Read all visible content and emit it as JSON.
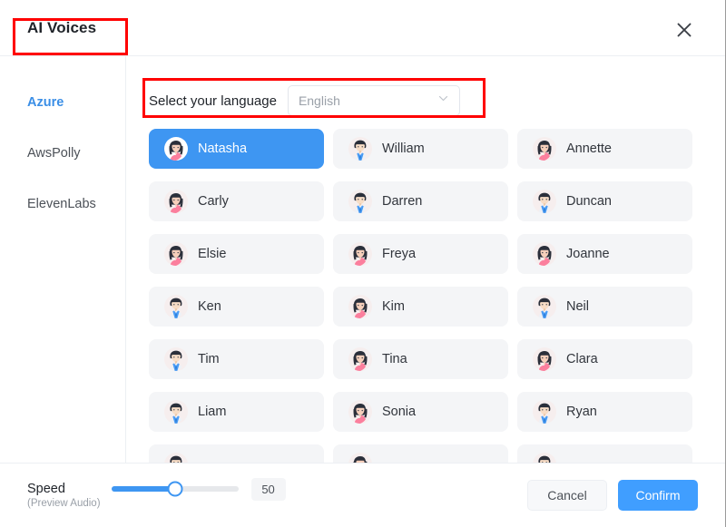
{
  "header": {
    "title": "AI Voices",
    "close_icon": "close-icon"
  },
  "sidebar": {
    "items": [
      {
        "label": "Azure",
        "active": true
      },
      {
        "label": "AwsPolly",
        "active": false
      },
      {
        "label": "ElevenLabs",
        "active": false
      }
    ]
  },
  "language": {
    "label": "Select your language",
    "selected": "English",
    "chevron_icon": "chevron-down-icon"
  },
  "voices": [
    {
      "name": "Natasha",
      "gender": "female",
      "selected": true
    },
    {
      "name": "William",
      "gender": "male",
      "selected": false
    },
    {
      "name": "Annette",
      "gender": "female",
      "selected": false
    },
    {
      "name": "Carly",
      "gender": "female",
      "selected": false
    },
    {
      "name": "Darren",
      "gender": "male",
      "selected": false
    },
    {
      "name": "Duncan",
      "gender": "male",
      "selected": false
    },
    {
      "name": "Elsie",
      "gender": "female",
      "selected": false
    },
    {
      "name": "Freya",
      "gender": "female",
      "selected": false
    },
    {
      "name": "Joanne",
      "gender": "female",
      "selected": false
    },
    {
      "name": "Ken",
      "gender": "male",
      "selected": false
    },
    {
      "name": "Kim",
      "gender": "female",
      "selected": false
    },
    {
      "name": "Neil",
      "gender": "male",
      "selected": false
    },
    {
      "name": "Tim",
      "gender": "male",
      "selected": false
    },
    {
      "name": "Tina",
      "gender": "female",
      "selected": false
    },
    {
      "name": "Clara",
      "gender": "female",
      "selected": false
    },
    {
      "name": "Liam",
      "gender": "male",
      "selected": false
    },
    {
      "name": "Sonia",
      "gender": "female",
      "selected": false
    },
    {
      "name": "Ryan",
      "gender": "male",
      "selected": false
    },
    {
      "name": "",
      "gender": "male",
      "selected": false
    },
    {
      "name": "",
      "gender": "female",
      "selected": false
    },
    {
      "name": "",
      "gender": "male",
      "selected": false
    }
  ],
  "footer": {
    "speed_label": "Speed",
    "speed_sublabel": "(Preview Audio)",
    "speed_value": "50",
    "speed_percent": 50,
    "cancel_label": "Cancel",
    "confirm_label": "Confirm"
  },
  "colors": {
    "accent": "#409eff",
    "selected_card": "#3e96f2",
    "card_bg": "#f4f5f7",
    "annotation": "#ff0000",
    "sidebar_active": "#3a8ee6"
  }
}
